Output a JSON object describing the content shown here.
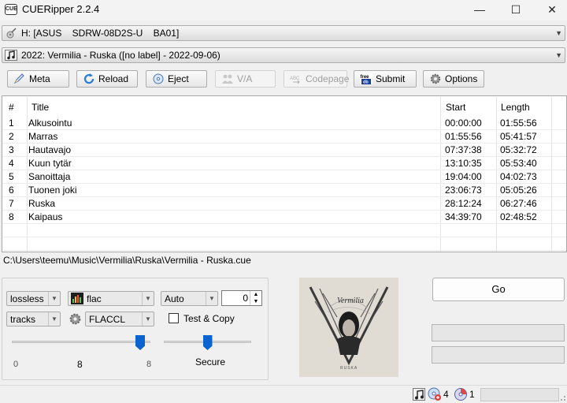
{
  "window": {
    "title": "CUERipper 2.2.4",
    "icon_text": "CUE",
    "minimize_glyph": "—",
    "maximize_glyph": "☐",
    "close_glyph": "✕"
  },
  "drive": {
    "value": "H: [ASUS    SDRW-08D2S-U    BA01]"
  },
  "release": {
    "value": "2022: Vermilia - Ruska ([no label] - 2022-09-06)"
  },
  "toolbar": {
    "meta": "Meta",
    "reload": "Reload",
    "eject": "Eject",
    "va": "V/A",
    "codepage": "Codepage",
    "submit": "Submit",
    "submit_icon_text_top": "freedb",
    "options": "Options"
  },
  "tracklist": {
    "columns": [
      "#",
      "Title",
      "Start",
      "Length"
    ],
    "rows": [
      [
        "1",
        "Alkusointu",
        "00:00:00",
        "01:55:56"
      ],
      [
        "2",
        "Marras",
        "01:55:56",
        "05:41:57"
      ],
      [
        "3",
        "Hautavajo",
        "07:37:38",
        "05:32:72"
      ],
      [
        "4",
        "Kuun tytär",
        "13:10:35",
        "05:53:40"
      ],
      [
        "5",
        "Sanoittaja",
        "19:04:00",
        "04:02:73"
      ],
      [
        "6",
        "Tuonen joki",
        "23:06:73",
        "05:05:26"
      ],
      [
        "7",
        "Ruska",
        "28:12:24",
        "06:27:46"
      ],
      [
        "8",
        "Kaipaus",
        "34:39:70",
        "02:48:52"
      ]
    ]
  },
  "output_path": "C:\\Users\\teemu\\Music\\Vermilia\\Ruska\\Vermilia - Ruska.cue",
  "settings": {
    "mode": "lossless",
    "format": "flac",
    "split": "tracks",
    "encoder": "FLACCL",
    "offset_mode": "Auto",
    "offset_value": "0",
    "test_copy_label": "Test & Copy",
    "test_copy_checked": false,
    "compression_min": "0",
    "compression_value": "8",
    "compression_max": "8",
    "compression_level_fraction": 1.0,
    "secure_label": "Secure",
    "secure_level_fraction": 0.5
  },
  "album_art": {
    "band_text": "Vermilia",
    "album_text": "RUSKA"
  },
  "go_button": "Go",
  "statusbar": {
    "count_a": "4",
    "count_b": "1"
  },
  "colors": {
    "accent": "#0a64d0",
    "window_bg": "#f0f0f0"
  }
}
